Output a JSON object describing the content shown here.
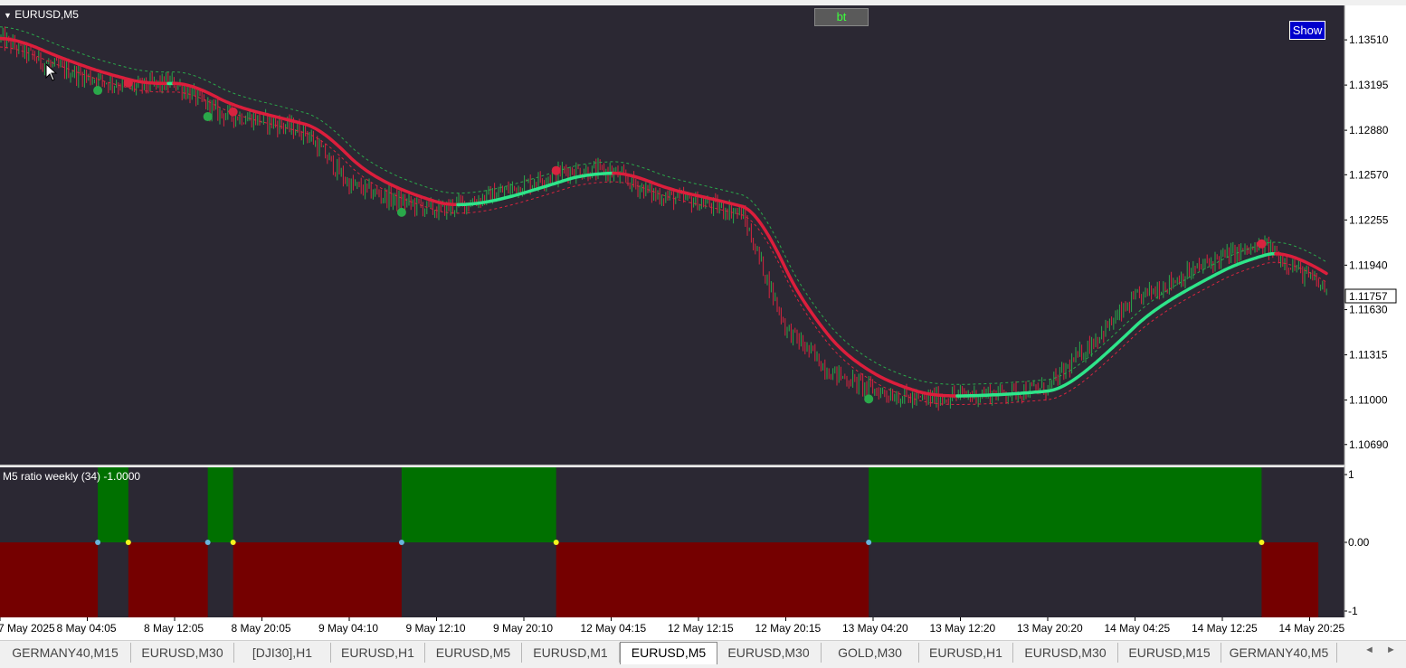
{
  "window": {
    "symbol_title": "EURUSD,M5",
    "bt_button": "bt",
    "show_button": "Show",
    "current_price": "1.11757"
  },
  "indicator": {
    "label": "M5 ratio weekly (34) -1.0000",
    "levels": [
      "1",
      "0.00",
      "-1"
    ]
  },
  "tabs": [
    "GERMANY40,M15",
    "EURUSD,M30",
    "[DJI30],H1",
    "EURUSD,H1",
    "EURUSD,M5",
    "EURUSD,M1",
    "EURUSD,M5",
    "EURUSD,M30",
    "GOLD,M30",
    "EURUSD,H1",
    "EURUSD,M30",
    "EURUSD,M15",
    "GERMANY40,M5"
  ],
  "active_tab_index": 6,
  "colors": {
    "background": "#2b2833",
    "bull_candle": "#2aa84a",
    "bear_candle": "#d8243f",
    "ma_up": "#2ee58a",
    "ma_down": "#dc1e3c",
    "ratio_positive": "#007000",
    "ratio_negative": "#750000",
    "marker_blue": "#6ab4dc",
    "marker_yellow": "#f5f51e"
  },
  "chart_data": [
    {
      "type": "line",
      "title": "EURUSD,M5",
      "y_ticks": [
        "1.13510",
        "1.13195",
        "1.12880",
        "1.12570",
        "1.12255",
        "1.11940",
        "1.11630",
        "1.11315",
        "1.11000",
        "1.10690"
      ],
      "x_ticks": [
        "7 May 2025",
        "8 May 04:05",
        "8 May 12:05",
        "8 May 20:05",
        "9 May 04:10",
        "9 May 12:10",
        "9 May 20:10",
        "12 May 04:15",
        "12 May 12:15",
        "12 May 20:15",
        "13 May 04:20",
        "13 May 12:20",
        "13 May 20:20",
        "14 May 04:25",
        "14 May 12:25",
        "14 May 20:25"
      ],
      "ylim": [
        1.1055,
        1.1375
      ],
      "grid": false,
      "series": [
        {
          "x": [
            0,
            0.5,
            1,
            1.5,
            2,
            2.5,
            3,
            3.5,
            4,
            4.5,
            5,
            5.5,
            6,
            6.5,
            7,
            7.5,
            8,
            8.5,
            9,
            9.5,
            10,
            10.5,
            11,
            11.5,
            12,
            12.5,
            13,
            13.5,
            14,
            14.5,
            15,
            15.2
          ],
          "values": [
            1.1352,
            1.1335,
            1.1325,
            1.1318,
            1.1321,
            1.13,
            1.1295,
            1.1287,
            1.125,
            1.124,
            1.1232,
            1.124,
            1.125,
            1.126,
            1.1259,
            1.1243,
            1.1238,
            1.123,
            1.115,
            1.112,
            1.1107,
            1.11,
            1.1103,
            1.1105,
            1.1108,
            1.114,
            1.117,
            1.1185,
            1.12,
            1.1207,
            1.1185,
            1.1176
          ]
        }
      ]
    },
    {
      "type": "bar",
      "title": "M5 ratio weekly (34) -1.0000",
      "ylim": [
        -1,
        1
      ],
      "x_ranges": [
        [
          -0.5,
          1.12
        ],
        [
          1.12,
          1.47
        ],
        [
          1.47,
          2.38
        ],
        [
          2.38,
          2.67
        ],
        [
          2.67,
          4.6
        ],
        [
          4.6,
          6.37
        ],
        [
          6.37,
          9.95
        ],
        [
          9.95,
          14.45
        ],
        [
          14.45,
          15.1
        ]
      ],
      "values": [
        -1,
        1,
        -1,
        1,
        -1,
        1,
        -1,
        1,
        -1
      ]
    }
  ]
}
